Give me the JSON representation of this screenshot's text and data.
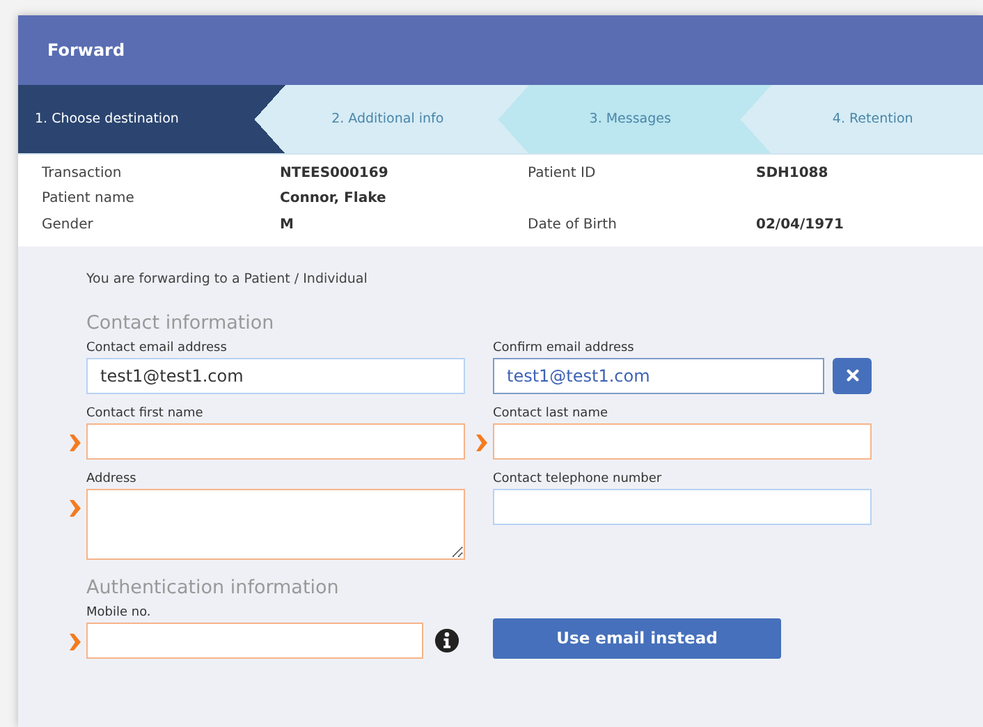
{
  "window": {
    "title": "Forward"
  },
  "steps": [
    {
      "label": "1. Choose destination",
      "selected": true,
      "color": "#2b4570"
    },
    {
      "label": "2. Additional info",
      "selected": false,
      "color": "#d7ecf5"
    },
    {
      "label": "3. Messages",
      "selected": false,
      "color": "#bce6f0"
    },
    {
      "label": "4. Retention",
      "selected": false,
      "color": "#d7ecf5"
    }
  ],
  "details": [
    {
      "items": [
        {
          "label": "Transaction",
          "value": "NTEES000169"
        },
        {
          "label": "Patient ID",
          "value": "SDH1088"
        }
      ]
    },
    {
      "items": [
        {
          "label": "Patient name",
          "value": "Connor, Flake"
        }
      ]
    },
    {
      "items": [
        {
          "label": "Gender",
          "value": "M"
        },
        {
          "label": "Date of Birth",
          "value": "02/04/1971"
        }
      ]
    }
  ],
  "intro": "You are forwarding to a Patient / Individual",
  "sections": [
    {
      "heading": "Contact information",
      "fields": [
        {
          "label": "Contact email address",
          "kind": "text",
          "required": false,
          "focused": false,
          "clearable": false,
          "info": false,
          "value": "test1@test1.com"
        },
        {
          "label": "Confirm email address",
          "kind": "text",
          "required": false,
          "focused": true,
          "clearable": true,
          "info": false,
          "value": "test1@test1.com"
        },
        {
          "label": "Contact first name",
          "kind": "text",
          "required": true,
          "focused": false,
          "clearable": false,
          "info": false
        },
        {
          "label": "Contact last name",
          "kind": "text",
          "required": true,
          "focused": false,
          "clearable": false,
          "info": false
        },
        {
          "label": "Address",
          "kind": "textarea",
          "required": true,
          "focused": false,
          "clearable": false,
          "info": false
        },
        {
          "label": "Contact telephone number",
          "kind": "text",
          "required": false,
          "focused": false,
          "clearable": false,
          "info": false
        }
      ]
    },
    {
      "heading": "Authentication information",
      "button": "Use email instead",
      "fields": [
        {
          "label": "Mobile no.",
          "kind": "text",
          "required": true,
          "focused": false,
          "clearable": false,
          "info": true
        }
      ]
    }
  ]
}
